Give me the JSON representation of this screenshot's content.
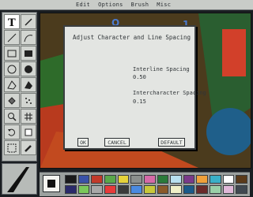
{
  "menu": {
    "items": [
      "Edit",
      "Options",
      "Brush",
      "Misc"
    ]
  },
  "tools": [
    "text-tool",
    "pencil-tool",
    "line-tool",
    "curve-tool",
    "rectangle-tool",
    "filled-rectangle-tool",
    "circle-tool",
    "filled-circle-tool",
    "polygon-tool",
    "filled-polygon-tool",
    "fill-tool",
    "airbrush-tool",
    "magnifier-tool",
    "grid-tool",
    "undo-tool",
    "clear-tool",
    "select-tool",
    "brush-tool"
  ],
  "dialog": {
    "title": "Adjust Character and Line Spacing",
    "interline_label": "Interline Spacing",
    "interline_value": "0.50",
    "intercharacter_label": "Intercharacter Spacing",
    "intercharacter_value": "0.15",
    "ok_label": "OK",
    "cancel_label": "CANCEL",
    "default_label": "DEFAULT"
  },
  "palette": {
    "colors": [
      "#1a1a1a",
      "#3a52a8",
      "#c23a2a",
      "#5aa84a",
      "#e6d23a",
      "#8a8f8d",
      "#d66aa8",
      "#2a7a3a",
      "#b8e0f0",
      "#7a3a8a",
      "#f0a03a",
      "#3ab0c8",
      "#ffffff",
      "#5a3a1a",
      "#2a2a6a",
      "#7ac85a",
      "#a8a8a8",
      "#e83a3a",
      "#3a3a3a",
      "#4a8ae0",
      "#c8c83a",
      "#8a5a2a",
      "#f0f0c8",
      "#1a5a8a",
      "#6a2a2a",
      "#9ad0a8",
      "#e0b8d8",
      "#404850"
    ]
  }
}
